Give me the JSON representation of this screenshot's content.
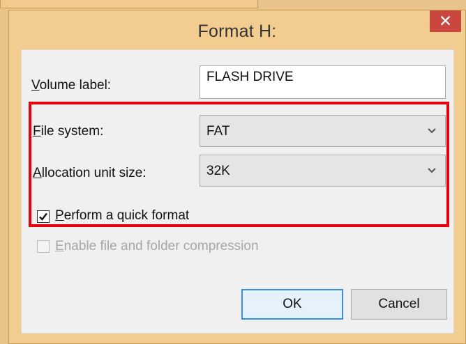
{
  "window": {
    "title": "Format H:",
    "close_glyph": "✕"
  },
  "volume_label": {
    "label_prefix": "V",
    "label_rest": "olume label:",
    "value": "FLASH DRIVE"
  },
  "file_system": {
    "label_prefix": "F",
    "label_rest": "ile system:",
    "selected": "FAT"
  },
  "allocation": {
    "label_prefix": "A",
    "label_rest": "llocation unit size:",
    "selected": "32K"
  },
  "quick_format": {
    "label_prefix": "P",
    "label_rest": "erform a quick format",
    "checked": true
  },
  "compression": {
    "label_prefix": "E",
    "label_rest": "nable file and folder compression",
    "checked": false,
    "enabled": false
  },
  "buttons": {
    "ok": "OK",
    "cancel": "Cancel"
  },
  "colors": {
    "highlight_box": "#e8000f",
    "close_button": "#c9473e",
    "window_frame": "#f3cd90"
  },
  "icons": {
    "close": "close-icon",
    "dropdown": "chevron-down-icon",
    "check": "checkmark-icon"
  }
}
